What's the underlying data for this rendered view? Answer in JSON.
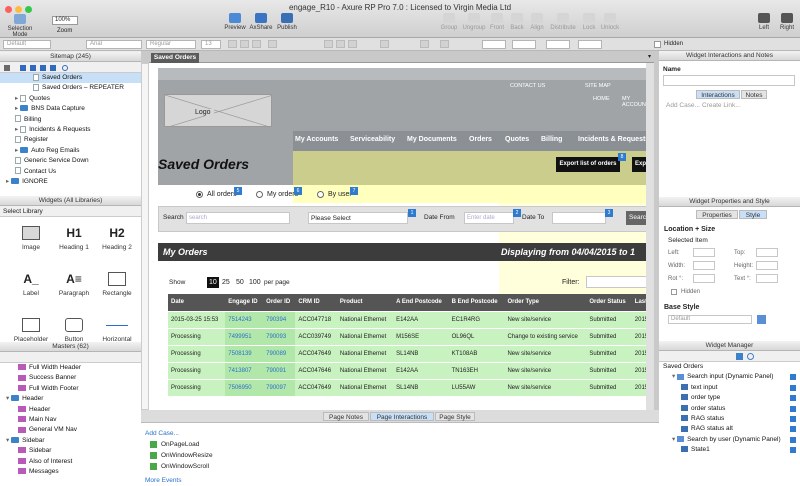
{
  "window": {
    "title": "engage_R10 - Axure RP Pro 7.0 : Licensed to Virgin Media Ltd"
  },
  "toolbar": {
    "selection_mode": "Selection Mode",
    "zoom_value": "100%",
    "zoom": "Zoom",
    "preview": "Preview",
    "axshare": "AxShare",
    "publish": "Publish",
    "group": "Group",
    "ungroup": "Ungroup",
    "front": "Front",
    "back": "Back",
    "align": "Align",
    "distribute": "Distribute",
    "lock": "Lock",
    "unlock": "Unlock",
    "left": "Left",
    "right": "Right"
  },
  "format": {
    "style": "Default",
    "font": "Arial",
    "weight": "Regular",
    "size": "13",
    "hidden": "Hidden"
  },
  "sitemap": {
    "title": "Sitemap (245)",
    "items": [
      {
        "label": "Saved Orders",
        "indent": 3,
        "icon": "page",
        "selected": true
      },
      {
        "label": "Saved Orders – REPEATER",
        "indent": 3,
        "icon": "page"
      },
      {
        "label": "Quotes",
        "indent": 1,
        "icon": "page",
        "arrow": true
      },
      {
        "label": "BNS Data Capture",
        "indent": 1,
        "icon": "folder",
        "arrow": true
      },
      {
        "label": "Billing",
        "indent": 1,
        "icon": "page"
      },
      {
        "label": "Incidents & Requests",
        "indent": 1,
        "icon": "page",
        "arrow": true
      },
      {
        "label": "Register",
        "indent": 1,
        "icon": "page"
      },
      {
        "label": "Auto Reg Emails",
        "indent": 1,
        "icon": "folder",
        "arrow": true
      },
      {
        "label": "Generic Service Down",
        "indent": 1,
        "icon": "page"
      },
      {
        "label": "Contact Us",
        "indent": 1,
        "icon": "page"
      },
      {
        "label": "IGNORE",
        "indent": 0,
        "icon": "folder",
        "arrow": true
      }
    ]
  },
  "widgets": {
    "title": "Widgets (All Libraries)",
    "select_label": "Select Library",
    "items": [
      {
        "label": "Image",
        "glyph": ""
      },
      {
        "label": "Heading 1",
        "glyph": "H1"
      },
      {
        "label": "Heading 2",
        "glyph": "H2"
      },
      {
        "label": "Label",
        "glyph": "A_"
      },
      {
        "label": "Paragraph",
        "glyph": "A≡"
      },
      {
        "label": "Rectangle",
        "glyph": ""
      },
      {
        "label": "Placeholder",
        "glyph": ""
      },
      {
        "label": "Button Shape",
        "glyph": ""
      },
      {
        "label": "Horizontal Line",
        "glyph": ""
      }
    ]
  },
  "masters": {
    "title": "Masters (62)",
    "items": [
      {
        "label": "Full Width Header",
        "indent": 1,
        "icon": "master"
      },
      {
        "label": "Success Banner",
        "indent": 1,
        "icon": "master"
      },
      {
        "label": "Full Width Footer",
        "indent": 1,
        "icon": "master"
      },
      {
        "label": "Header",
        "indent": 0,
        "icon": "folder",
        "arrow": true
      },
      {
        "label": "Header",
        "indent": 1,
        "icon": "master"
      },
      {
        "label": "Main Nav",
        "indent": 1,
        "icon": "master"
      },
      {
        "label": "General VM Nav",
        "indent": 1,
        "icon": "master"
      },
      {
        "label": "Sidebar",
        "indent": 0,
        "icon": "folder",
        "arrow": true
      },
      {
        "label": "Sidebar",
        "indent": 1,
        "icon": "master"
      },
      {
        "label": "Also of Interest",
        "indent": 1,
        "icon": "master"
      },
      {
        "label": "Messages",
        "indent": 1,
        "icon": "master"
      }
    ]
  },
  "canvas": {
    "tab": "Saved Orders",
    "top_links": [
      "CONTACT US",
      "SITE MAP",
      "HOME",
      "MY ACCOUNT"
    ],
    "logo": "Logo",
    "nav": [
      "My Accounts",
      "Serviceability",
      "My Documents",
      "Orders",
      "Quotes",
      "Billing",
      "Incidents & Requests"
    ],
    "page_title": "Saved Orders",
    "export_btn": "Export list of orders",
    "export_btn2": "Expo",
    "radios": [
      "All orders",
      "My orders",
      "By user"
    ],
    "search_label": "Search",
    "search_placeholder": "search",
    "select_value": "Please Select",
    "date_from": "Date From",
    "date_placeholder": "Enter date",
    "date_to": "Date To",
    "search_btn": "Search",
    "annotations": [
      "1",
      "2",
      "3",
      "4",
      "5",
      "6",
      "7",
      "8"
    ],
    "orders_title": "My Orders",
    "displaying": "Displaying from 04/04/2015 to 1",
    "show": "Show",
    "page_sizes": [
      "10",
      "25",
      "50",
      "100"
    ],
    "per_page": "per page",
    "filter": "Filter:",
    "columns": [
      "Date",
      "Engage ID",
      "Order ID",
      "CRM ID",
      "Product",
      "A End Postcode",
      "B End Postcode",
      "Order Type",
      "Order Status",
      "Last U"
    ],
    "rows": [
      [
        "2015-03-25 15:53",
        "7514243",
        "790394",
        "ACC047718",
        "National Ethernet",
        "E142AA",
        "EC1R4RG",
        "New site/service",
        "Submitted",
        "2015"
      ],
      [
        "Processing",
        "7499951",
        "790093",
        "ACC039749",
        "National Ethernet",
        "M156SE",
        "OL96QL",
        "Change to existing service",
        "Submitted",
        "2015"
      ],
      [
        "Processing",
        "7508139",
        "790089",
        "ACC047649",
        "National Ethernet",
        "SL14NB",
        "KT108AB",
        "New site/service",
        "Submitted",
        "2015"
      ],
      [
        "Processing",
        "7413807",
        "790091",
        "ACC047646",
        "National Ethernet",
        "E142AA",
        "TN163EH",
        "New site/service",
        "Submitted",
        "2015"
      ],
      [
        "Processing",
        "7506950",
        "790097",
        "ACC047649",
        "National Ethernet",
        "SL14NB",
        "LU55AW",
        "New site/service",
        "Submitted",
        "2015"
      ]
    ]
  },
  "bottom": {
    "tabs": [
      "Page Notes",
      "Page Interactions",
      "Page Style"
    ],
    "add_case": "Add Case...",
    "events": [
      "OnPageLoad",
      "OnWindowResize",
      "OnWindowScroll"
    ],
    "more_events": "More Events"
  },
  "interactions": {
    "title": "Widget Interactions and Notes",
    "name_label": "Name",
    "tabs": [
      "Interactions",
      "Notes"
    ],
    "add_case": "Add Case...",
    "create_link": "Create Link..."
  },
  "properties": {
    "title": "Widget Properties and Style",
    "tabs": [
      "Properties",
      "Style"
    ],
    "location_size": "Location + Size",
    "selected_item": "Selected Item",
    "left": "Left:",
    "top": "Top:",
    "width": "Width:",
    "height": "Height:",
    "rot": "Rot °:",
    "text": "Text °:",
    "hidden": "Hidden",
    "base_style": "Base Style",
    "default": "Default"
  },
  "manager": {
    "title": "Widget Manager",
    "items": [
      {
        "label": "Saved Orders",
        "indent": 0
      },
      {
        "label": "Search input (Dynamic Panel)",
        "indent": 1,
        "folder": true
      },
      {
        "label": "text input",
        "indent": 2
      },
      {
        "label": "order type",
        "indent": 2
      },
      {
        "label": "order status",
        "indent": 2
      },
      {
        "label": "RAG status",
        "indent": 2
      },
      {
        "label": "RAG status alt",
        "indent": 2
      },
      {
        "label": "Search by user (Dynamic Panel)",
        "indent": 1,
        "folder": true
      },
      {
        "label": "State1",
        "indent": 2
      }
    ]
  },
  "colors": {
    "accent": "#2e7bd0",
    "selected_row": "#c8e0f7",
    "table_green": "#c8f2c0",
    "header_grey": "#a0a4a7"
  }
}
